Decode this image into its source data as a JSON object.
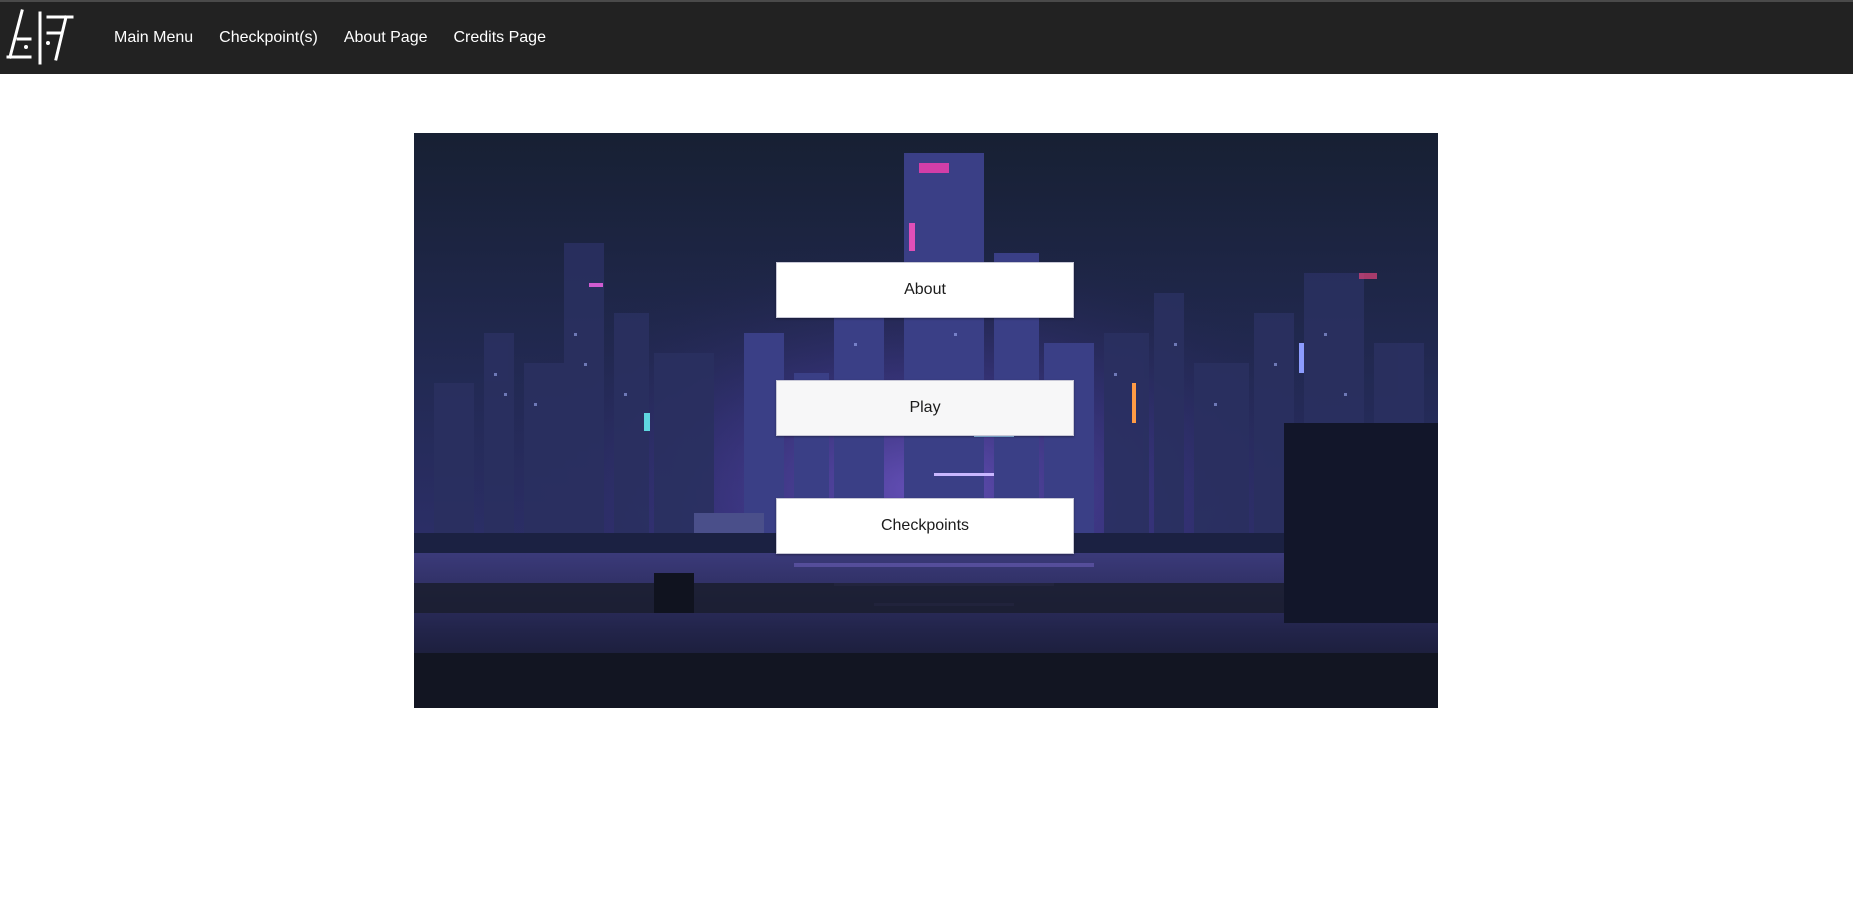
{
  "header": {
    "logo_icon": "stylized-glyph-logo-icon",
    "nav": [
      {
        "label": "Main Menu"
      },
      {
        "label": "Checkpoint(s)"
      },
      {
        "label": "About Page"
      },
      {
        "label": "Credits Page"
      }
    ]
  },
  "main": {
    "background_image": "neon-city-night-skyline",
    "buttons": {
      "about": "About",
      "play": "Play",
      "checkpoints": "Checkpoints"
    }
  },
  "colors": {
    "topbar": "#222222",
    "nav_text": "#ffffff",
    "page_background": "#ffffff",
    "button_background": "#ffffff",
    "button_text": "#1b1b1b"
  }
}
